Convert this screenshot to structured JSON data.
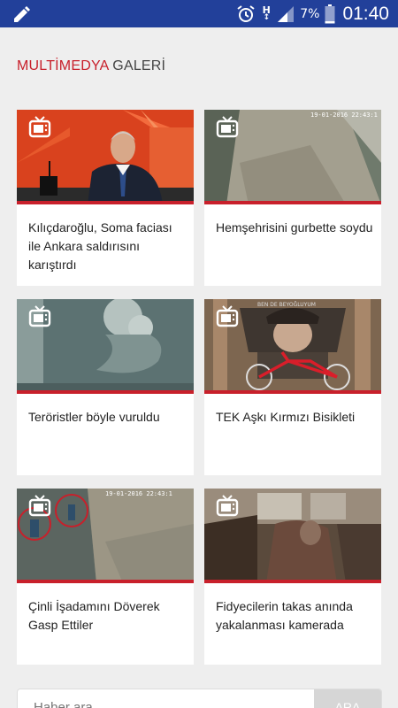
{
  "status_bar": {
    "network": "H",
    "network_sub": "↕",
    "battery": "7%",
    "time": "01:40",
    "color": "#22409a"
  },
  "section": {
    "title_red": "MULTİMEDYA",
    "title_dark": "GALERİ",
    "accent": "#c8202b"
  },
  "cards": [
    {
      "title": "Kılıçdaroğlu, Soma faciası ile Ankara saldırısını karıştırdı",
      "media": "video",
      "image": "politician-at-podium"
    },
    {
      "title": "Hemşehrisini gurbette soydu",
      "media": "video",
      "image": "cctv-street"
    },
    {
      "title": "Teröristler böyle vuruldu",
      "media": "video",
      "image": "thermal-footage"
    },
    {
      "title": "TEK Aşkı Kırmızı Bisikleti",
      "media": "video",
      "image": "red-bicycle-mural"
    },
    {
      "title": "Çinli İşadamını Döverek Gasp Ettiler",
      "media": "video",
      "image": "cctv-robbery"
    },
    {
      "title": "Fidyecilerin takas anında yakalanması kamerada",
      "media": "video",
      "image": "bus-interior"
    }
  ],
  "search": {
    "placeholder": "Haber ara...",
    "button": "ARA"
  }
}
